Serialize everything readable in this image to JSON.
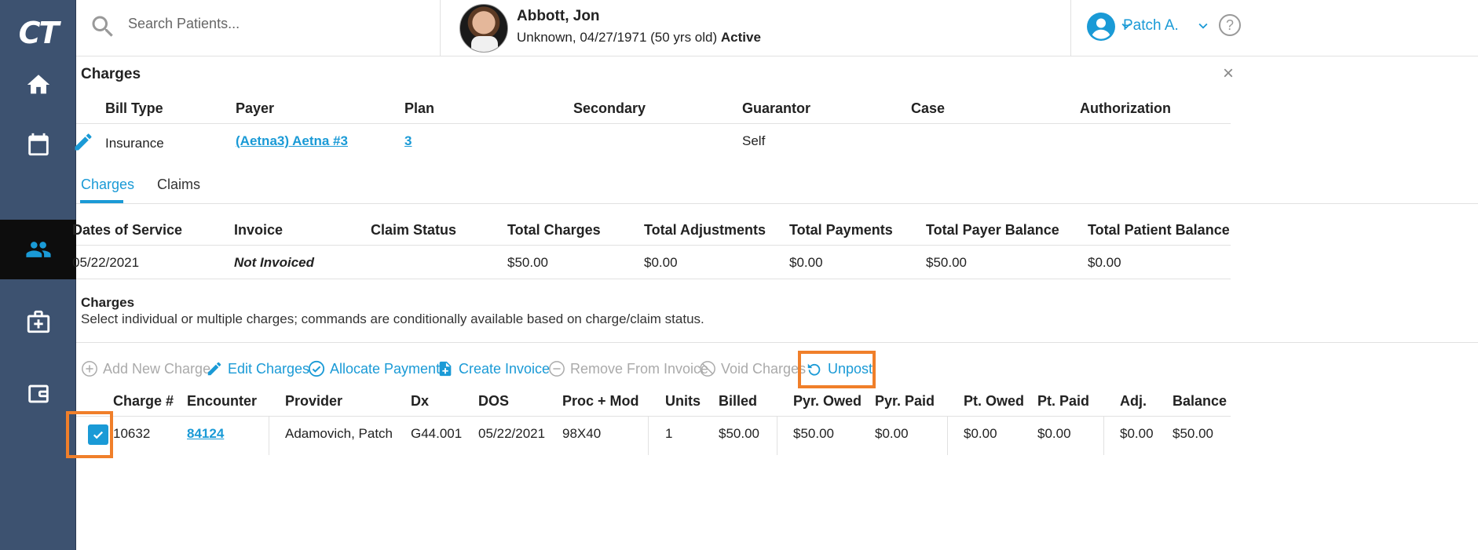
{
  "app": {
    "logo_text": "CT"
  },
  "sidebar": {
    "items": [
      {
        "name": "home",
        "icon": "home-icon"
      },
      {
        "name": "schedule",
        "icon": "calendar-icon"
      },
      {
        "name": "patients",
        "icon": "people-icon",
        "active": true
      },
      {
        "name": "clinical",
        "icon": "medical-kit-icon"
      },
      {
        "name": "billing",
        "icon": "wallet-icon"
      }
    ]
  },
  "header": {
    "search_placeholder": "Search Patients...",
    "patient": {
      "name": "Abbott, Jon",
      "info": "Unknown, 04/27/1971 (50 yrs old)",
      "status": "Active"
    },
    "user": {
      "name": "Patch A."
    }
  },
  "charges_panel": {
    "title": "Charges",
    "bill_headers": [
      "Bill Type",
      "Payer",
      "Plan",
      "Secondary",
      "Guarantor",
      "Case",
      "Authorization"
    ],
    "bill_row": {
      "bill_type": "Insurance",
      "payer": "(Aetna3) Aetna #3",
      "plan": "3",
      "secondary": "",
      "guarantor": "Self",
      "case": "",
      "authorization": ""
    },
    "tabs": [
      {
        "label": "Charges",
        "active": true
      },
      {
        "label": "Claims",
        "active": false
      }
    ],
    "summary_headers": [
      "Dates of Service",
      "Invoice",
      "Claim Status",
      "Total Charges",
      "Total Adjustments",
      "Total Payments",
      "Total Payer Balance",
      "Total Patient Balance"
    ],
    "summary_row": {
      "dates_of_service": "05/22/2021",
      "invoice": "Not Invoiced",
      "claim_status": "",
      "total_charges": "$50.00",
      "total_adjustments": "$0.00",
      "total_payments": "$0.00",
      "total_payer_balance": "$50.00",
      "total_patient_balance": "$0.00"
    },
    "charges_section": {
      "title": "Charges",
      "description": "Select individual or multiple charges; commands are conditionally available based on charge/claim status."
    },
    "toolbar": [
      {
        "label": "Add New Charge",
        "icon": "plus-circle-icon",
        "enabled": false
      },
      {
        "label": "Edit Charges",
        "icon": "pencil-icon",
        "enabled": true
      },
      {
        "label": "Allocate Payment",
        "icon": "check-circle-icon",
        "enabled": true
      },
      {
        "label": "Create Invoice",
        "icon": "document-plus-icon",
        "enabled": true
      },
      {
        "label": "Remove From Invoice",
        "icon": "minus-circle-icon",
        "enabled": false
      },
      {
        "label": "Void Charges",
        "icon": "ban-icon",
        "enabled": false
      },
      {
        "label": "Unpost",
        "icon": "undo-icon",
        "enabled": true,
        "highlighted": true
      }
    ],
    "charge_headers": [
      "Charge #",
      "Encounter",
      "Provider",
      "Dx",
      "DOS",
      "Proc + Mod",
      "Units",
      "Billed",
      "Pyr. Owed",
      "Pyr. Paid",
      "Pt. Owed",
      "Pt. Paid",
      "Adj.",
      "Balance"
    ],
    "charge_rows": [
      {
        "selected": true,
        "charge_no": "10632",
        "encounter": "84124",
        "provider": "Adamovich, Patch",
        "dx": "G44.001",
        "dos": "05/22/2021",
        "proc_mod": "98X40",
        "units": "1",
        "billed": "$50.00",
        "pyr_owed": "$50.00",
        "pyr_paid": "$0.00",
        "pt_owed": "$0.00",
        "pt_paid": "$0.00",
        "adj": "$0.00",
        "balance": "$50.00"
      }
    ]
  },
  "colors": {
    "accent": "#1a9ad6",
    "sidebar": "#3d5270",
    "highlight": "#f07f2a"
  }
}
